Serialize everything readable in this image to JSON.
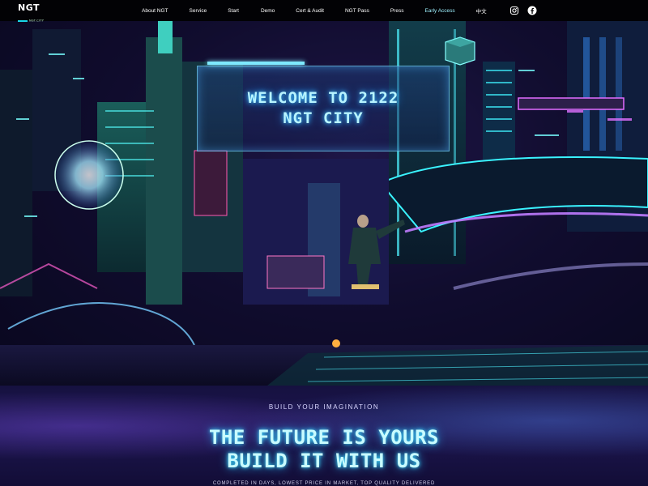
{
  "nav": {
    "logo": {
      "main": "NGT",
      "sub": "NGT.CITY"
    },
    "items": [
      {
        "label": "About NGT"
      },
      {
        "label": "Service"
      },
      {
        "label": "Start"
      },
      {
        "label": "Demo"
      },
      {
        "label": "Cert & Audit"
      },
      {
        "label": "NGT Pass"
      },
      {
        "label": "Press"
      },
      {
        "label": "Early Access",
        "highlighted": true
      },
      {
        "label": "中文"
      }
    ],
    "social": [
      {
        "icon": "instagram-icon"
      },
      {
        "icon": "facebook-icon"
      }
    ]
  },
  "hero": {
    "welcome_line1": "WELCOME TO 2122",
    "welcome_line2": "NGT CITY"
  },
  "section": {
    "label": "BUILD YOUR IMAGINATION",
    "headline_line1": "THE FUTURE IS YOURS",
    "headline_line2": "BUILD IT WITH US",
    "tagline": "COMPLETED IN DAYS, LOWEST PRICE IN MARKET, TOP QUALITY DELIVERED"
  },
  "colors": {
    "accent": "#19d6e8",
    "neon_text": "#b8f4ff",
    "nav_bg": "#020205",
    "lower_bg": "#1d1650"
  }
}
